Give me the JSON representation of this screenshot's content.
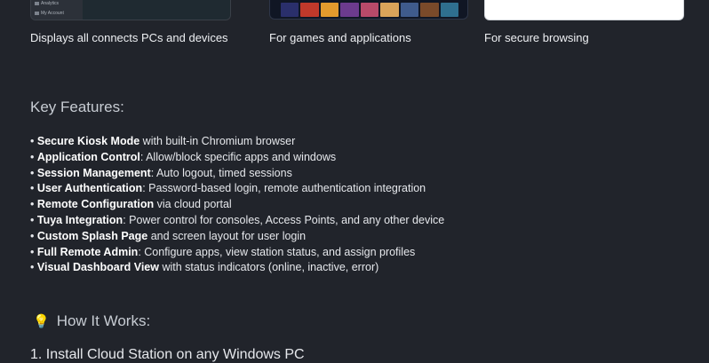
{
  "cards": [
    {
      "caption": "Displays all connects PCs and devices",
      "menu_items": [
        "Analytics",
        "My Account"
      ]
    },
    {
      "caption": "For games and applications",
      "tile_colors": [
        "#2a2f6b",
        "#c0392b",
        "#e39a2d",
        "#6c3b8e",
        "#b84a6a",
        "#d9a35a",
        "#3f5b8c",
        "#7a4a2a",
        "#2f6f8f"
      ]
    },
    {
      "caption": "For secure browsing"
    }
  ],
  "key_features": {
    "title": "Key Features:",
    "items": [
      {
        "bold": "Secure Kiosk Mode",
        "rest": " with built-in Chromium browser"
      },
      {
        "bold": "Application Control",
        "rest": ": Allow/block specific apps and windows"
      },
      {
        "bold": "Session Management",
        "rest": ": Auto logout, timed sessions"
      },
      {
        "bold": "User Authentication",
        "rest": ": Password-based login, remote authentication integration"
      },
      {
        "bold": "Remote Configuration",
        "rest": " via cloud portal"
      },
      {
        "bold": "Tuya Integration",
        "rest": ": Power control for consoles, Access Points, and any other device"
      },
      {
        "bold": "Custom Splash Page",
        "rest": " and screen layout for user login"
      },
      {
        "bold": "Full Remote Admin",
        "rest": ": Configure apps, view station status, and assign profiles"
      },
      {
        "bold": "Visual Dashboard View",
        "rest": " with status indicators (online, inactive, error)"
      }
    ],
    "bullet": "•"
  },
  "how_it_works": {
    "icon": "lightbulb-icon",
    "title": "How It Works:",
    "steps": [
      "1. Install Cloud Station on any Windows PC"
    ]
  }
}
